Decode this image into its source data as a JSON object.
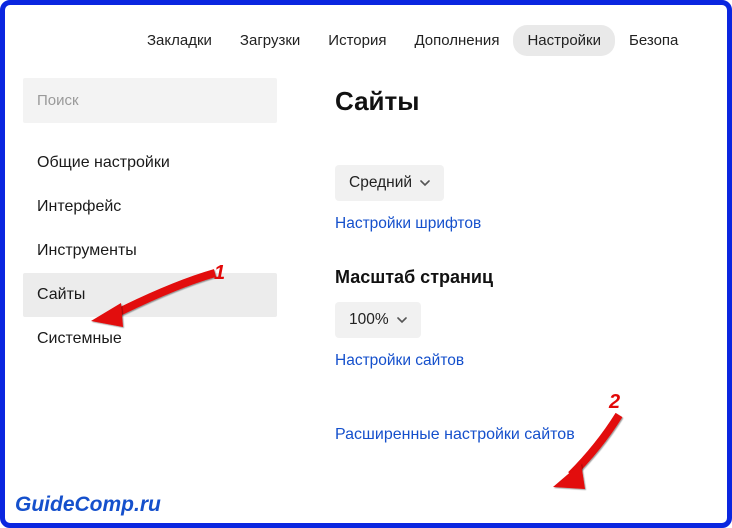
{
  "topnav": {
    "items": [
      {
        "label": "Закладки"
      },
      {
        "label": "Загрузки"
      },
      {
        "label": "История"
      },
      {
        "label": "Дополнения"
      },
      {
        "label": "Настройки",
        "active": true
      },
      {
        "label": "Безопа"
      }
    ]
  },
  "sidebar": {
    "search_placeholder": "Поиск",
    "items": [
      {
        "label": "Общие настройки"
      },
      {
        "label": "Интерфейс"
      },
      {
        "label": "Инструменты"
      },
      {
        "label": "Сайты",
        "active": true
      },
      {
        "label": "Системные"
      }
    ]
  },
  "content": {
    "title": "Сайты",
    "font_size": {
      "selected": "Средний",
      "link": "Настройки шрифтов"
    },
    "zoom": {
      "heading": "Масштаб страниц",
      "selected": "100%",
      "link": "Настройки сайтов"
    },
    "advanced_link": "Расширенные настройки сайтов"
  },
  "annotations": {
    "one": "1",
    "two": "2"
  },
  "watermark": "GuideComp.ru"
}
